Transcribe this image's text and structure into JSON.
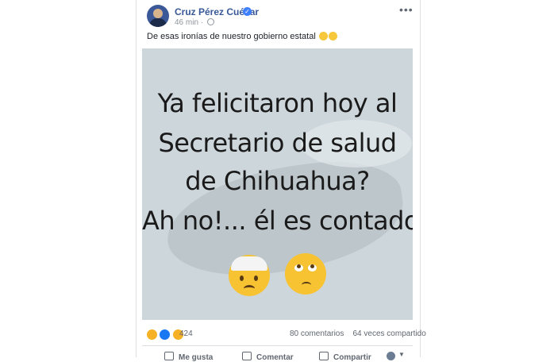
{
  "post": {
    "author": "Cruz Pérez Cuéllar",
    "time": "46 min",
    "text": "De esas ironías de nuestro gobierno estatal",
    "image_lines": [
      "Ya felicitaron hoy al",
      "Secretario de salud",
      "de Chihuahua?",
      "Ah no!... él es contador"
    ]
  },
  "stats": {
    "reaction_count": "424",
    "comments": "80 comentarios",
    "shares": "64 veces compartido"
  },
  "actions": {
    "like": "Me gusta",
    "comment": "Comentar",
    "share": "Compartir"
  },
  "colors": {
    "link_blue": "#385898",
    "verified_blue": "#4080ff",
    "image_bg": "#cdd6db",
    "emoji_yellow": "#f7c332"
  },
  "icons": [
    "verified-badge-icon",
    "globe-icon",
    "more-options-icon",
    "haha-reaction-icon",
    "like-reaction-icon",
    "wow-reaction-icon",
    "like-action-icon",
    "comment-action-icon",
    "share-action-icon"
  ]
}
